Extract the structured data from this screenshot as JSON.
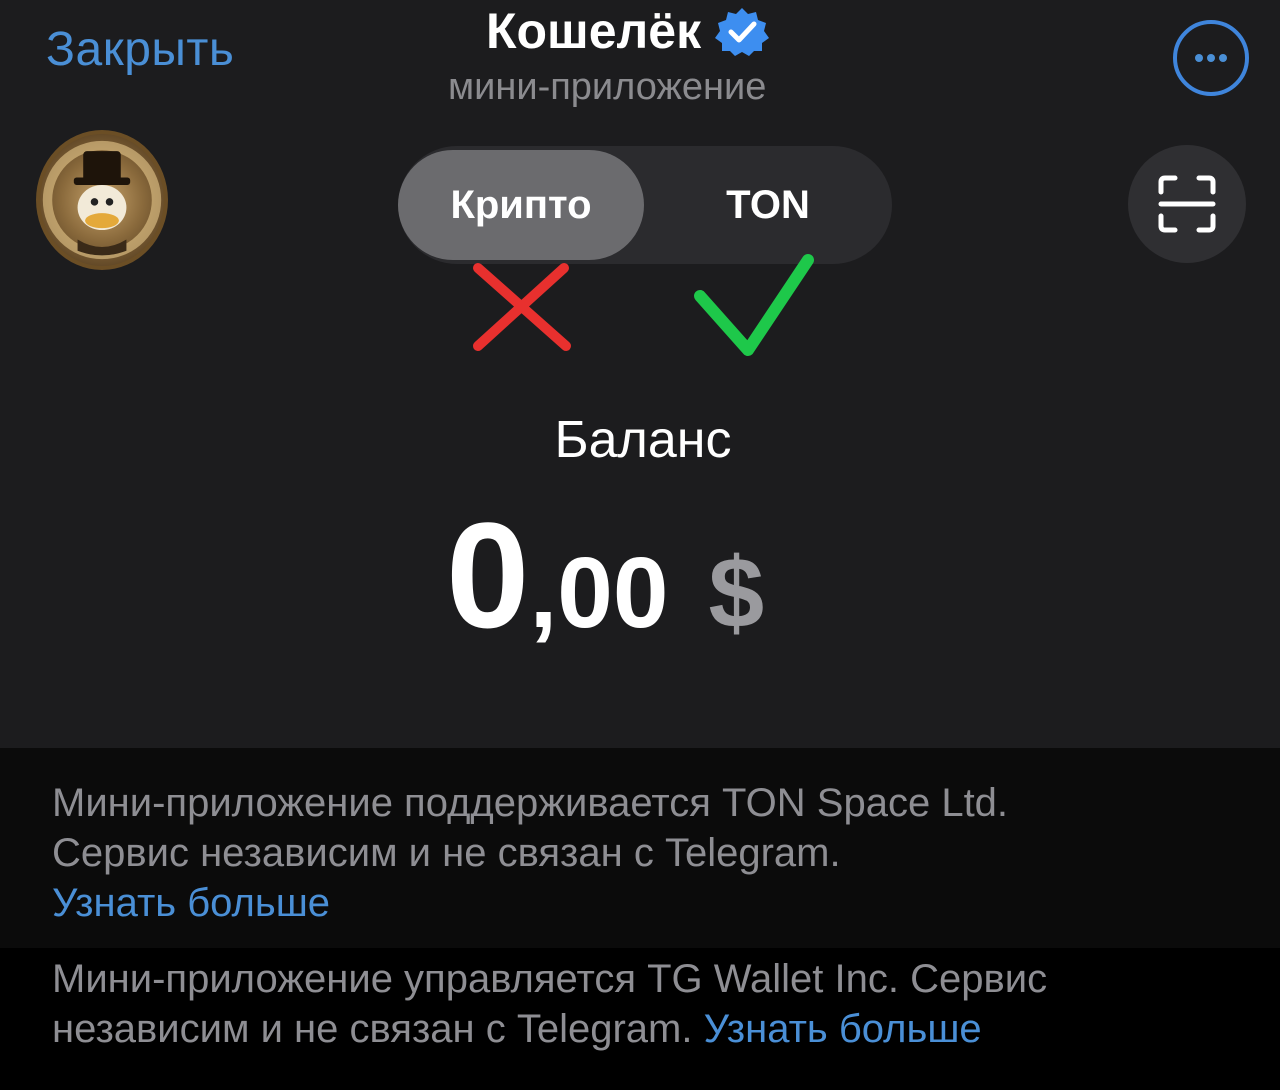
{
  "header": {
    "close_label": "Закрыть",
    "title": "Кошелёк",
    "subtitle": "мини-приложение",
    "verified_icon": "verified-badge-icon",
    "menu_icon": "more-dots-icon"
  },
  "tabs": {
    "active": "Крипто",
    "inactive": "TON"
  },
  "marks": {
    "cross_color": "#e8302e",
    "check_color": "#1ec84a"
  },
  "balance": {
    "label": "Баланс",
    "integer": "0",
    "fraction": ",00",
    "currency": "$"
  },
  "footer": {
    "line1": "Мини-приложение поддерживается TON Space Ltd.",
    "line2": "Сервис независим и не связан с Telegram.",
    "link1": "Узнать больше",
    "line3": "Мини-приложение управляется TG Wallet Inc. Сервис",
    "line4": "независим и не связан с Telegram.",
    "link2": "Узнать больше"
  },
  "colors": {
    "accent": "#4a8fd6",
    "background": "#1c1c1e"
  }
}
